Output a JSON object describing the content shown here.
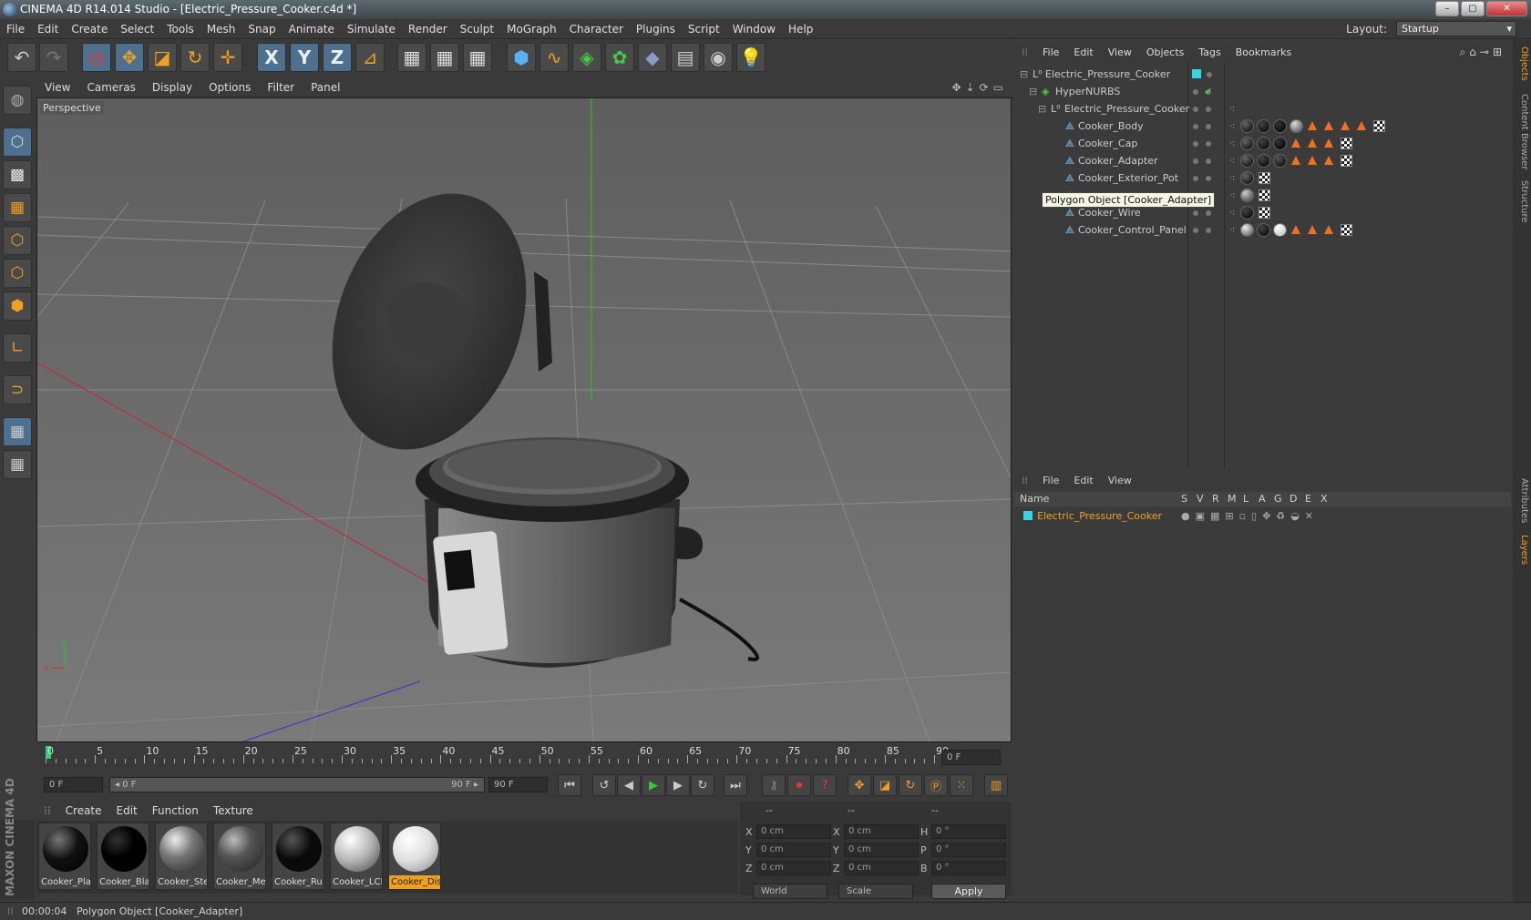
{
  "window": {
    "title": "CINEMA 4D R14.014 Studio - [Electric_Pressure_Cooker.c4d *]",
    "buttons": [
      "–",
      "▢",
      "✕"
    ]
  },
  "menu": {
    "items": [
      "File",
      "Edit",
      "Create",
      "Select",
      "Tools",
      "Mesh",
      "Snap",
      "Animate",
      "Simulate",
      "Render",
      "Sculpt",
      "MoGraph",
      "Character",
      "Plugins",
      "Script",
      "Window",
      "Help"
    ],
    "layout_label": "Layout:",
    "layout_value": "Startup"
  },
  "toolbar": {
    "undo": "↶",
    "redo": "↷",
    "x": "X",
    "y": "Y",
    "z": "Z"
  },
  "viewport": {
    "menu": [
      "View",
      "Cameras",
      "Display",
      "Options",
      "Filter",
      "Panel"
    ],
    "label": "Perspective"
  },
  "timeline": {
    "ticks": [
      "0",
      "5",
      "10",
      "15",
      "20",
      "25",
      "30",
      "35",
      "40",
      "45",
      "50",
      "55",
      "60",
      "65",
      "70",
      "75",
      "80",
      "85",
      "90"
    ],
    "current_frame": "0 F"
  },
  "transport": {
    "start_field": "0 F",
    "range_start": "◂ 0 F",
    "range_end": "90 F ▸",
    "end_field": "90 F"
  },
  "materials": {
    "menu": [
      "Create",
      "Edit",
      "Function",
      "Texture"
    ],
    "items": [
      {
        "label": "Cooker_Pla",
        "style": "black"
      },
      {
        "label": "Cooker_Bla",
        "style": "black2"
      },
      {
        "label": "Cooker_Ste",
        "style": "steel"
      },
      {
        "label": "Cooker_Me",
        "style": "metal"
      },
      {
        "label": "Cooker_Ru",
        "style": "rubber"
      },
      {
        "label": "Cooker_LCI",
        "style": "lcd"
      },
      {
        "label": "Cooker_Dis",
        "style": "display"
      }
    ],
    "selected_index": 6
  },
  "coords": {
    "headers": [
      "--",
      "--",
      "--"
    ],
    "rows": [
      {
        "a": "X",
        "av": "0 cm",
        "b": "X",
        "bv": "0 cm",
        "c": "H",
        "cv": "0 °"
      },
      {
        "a": "Y",
        "av": "0 cm",
        "b": "Y",
        "bv": "0 cm",
        "c": "P",
        "cv": "0 °"
      },
      {
        "a": "Z",
        "av": "0 cm",
        "b": "Z",
        "bv": "0 cm",
        "c": "B",
        "cv": "0 °"
      }
    ],
    "mode": "World",
    "scale": "Scale",
    "apply": "Apply"
  },
  "object_manager": {
    "menu": [
      "File",
      "Edit",
      "View",
      "Objects",
      "Tags",
      "Bookmarks"
    ],
    "rows": [
      {
        "name": "Electric_Pressure_Cooker",
        "indent": 0
      },
      {
        "name": "HyperNURBS",
        "indent": 1
      },
      {
        "name": "Electric_Pressure_Cooker",
        "indent": 2
      },
      {
        "name": "Cooker_Body",
        "indent": 3
      },
      {
        "name": "Cooker_Cap",
        "indent": 3
      },
      {
        "name": "Cooker_Adapter",
        "indent": 3
      },
      {
        "name": "Cooker_Exterior_Pot",
        "indent": 3
      },
      {
        "name": "",
        "indent": 3
      },
      {
        "name": "Cooker_Wire",
        "indent": 3
      },
      {
        "name": "Cooker_Control_Panel",
        "indent": 3
      }
    ],
    "tooltip": "Polygon Object [Cooker_Adapter]"
  },
  "layer_manager": {
    "menu": [
      "File",
      "Edit",
      "View"
    ],
    "columns": [
      "Name",
      "S",
      "V",
      "R",
      "M",
      "L",
      "A",
      "G",
      "D",
      "E",
      "X"
    ],
    "layer_name": "Electric_Pressure_Cooker"
  },
  "right_tabs": [
    "Objects",
    "Content Browser",
    "Structure",
    "Attributes",
    "Layers"
  ],
  "status": {
    "time": "00:00:04",
    "message": "Polygon Object [Cooker_Adapter]"
  },
  "brand": "MAXON CINEMA 4D",
  "colors": {
    "accent": "#f0a020",
    "layer": "#3ad6e0",
    "tag_triangle": "#f07020"
  }
}
